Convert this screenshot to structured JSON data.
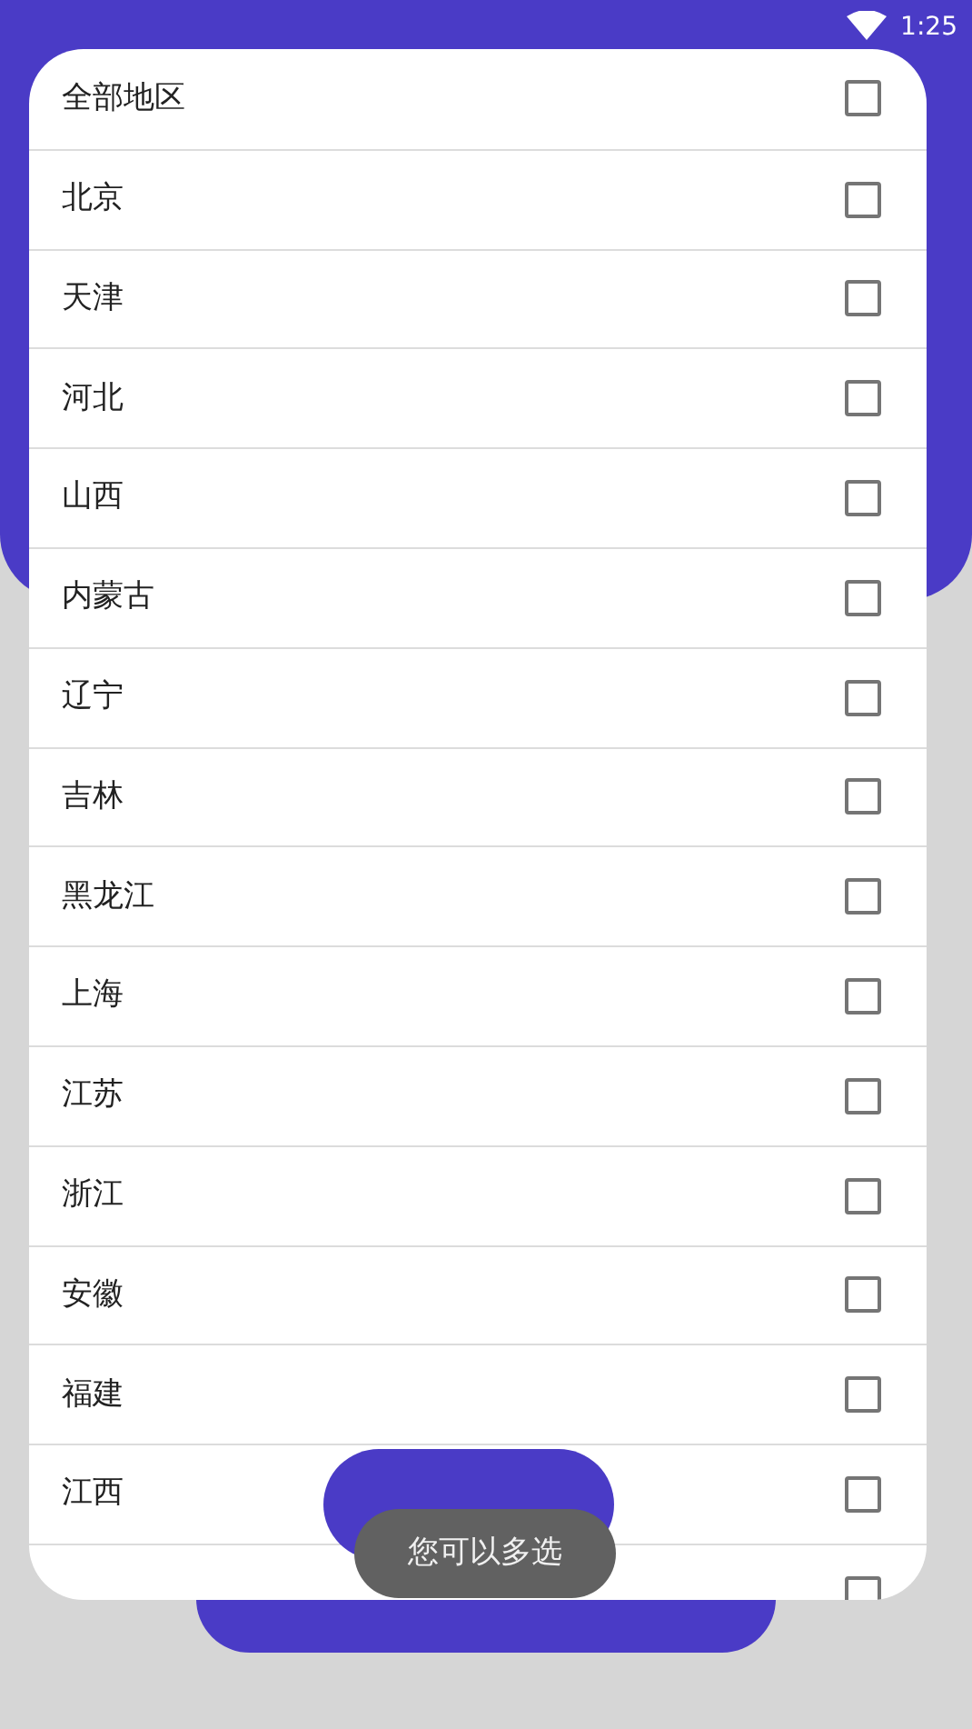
{
  "status_bar": {
    "time": "1:25"
  },
  "regions": [
    {
      "label": "全部地区",
      "checked": false
    },
    {
      "label": "北京",
      "checked": false
    },
    {
      "label": "天津",
      "checked": false
    },
    {
      "label": "河北",
      "checked": false
    },
    {
      "label": "山西",
      "checked": false
    },
    {
      "label": "内蒙古",
      "checked": false
    },
    {
      "label": "辽宁",
      "checked": false
    },
    {
      "label": "吉林",
      "checked": false
    },
    {
      "label": "黑龙江",
      "checked": false
    },
    {
      "label": "上海",
      "checked": false
    },
    {
      "label": "江苏",
      "checked": false
    },
    {
      "label": "浙江",
      "checked": false
    },
    {
      "label": "安徽",
      "checked": false
    },
    {
      "label": "福建",
      "checked": false
    },
    {
      "label": "江西",
      "checked": false
    },
    {
      "checked": false
    }
  ],
  "toast": "您可以多选"
}
